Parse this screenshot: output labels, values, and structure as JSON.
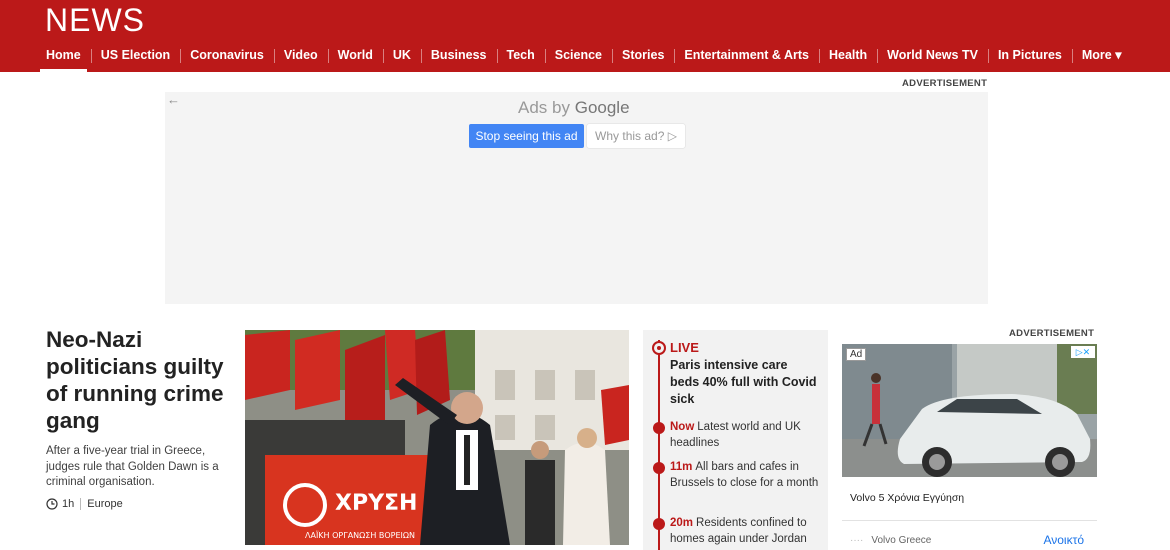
{
  "header": {
    "logo": "NEWS",
    "nav": [
      "Home",
      "US Election",
      "Coronavirus",
      "Video",
      "World",
      "UK",
      "Business",
      "Tech",
      "Science",
      "Stories",
      "Entertainment & Arts",
      "Health",
      "World News TV",
      "In Pictures",
      "More ▾"
    ],
    "active": "Home"
  },
  "top_ad": {
    "label": "ADVERTISEMENT",
    "ads_by": "Ads by",
    "google": "Google",
    "stop_label": "Stop seeing this ad",
    "why_label": "Why this ad? ▷",
    "back_icon": "arrow-left-icon"
  },
  "story": {
    "headline": "Neo-Nazi politicians guilty of running crime gang",
    "summary": "After a five-year trial in Greece, judges rule that Golden Dawn is a criminal organisation.",
    "time": "1h",
    "section": "Europe",
    "banner_text": "ΧΡΥΣΗ ΑΥ",
    "banner_subtext": "ΛΑΪΚΗ ΟΡΓΑΝΩΣΗ ΒΟΡΕΙΩΝ"
  },
  "live": {
    "tag": "LIVE",
    "title": "Paris intensive care beds 40% full with Covid sick",
    "entries": [
      {
        "time": "Now",
        "text": "Latest world and UK headlines"
      },
      {
        "time": "11m",
        "text": "All bars and cafes in Brussels to close for a month"
      },
      {
        "time": "20m",
        "text": "Residents confined to homes again under Jordan"
      }
    ]
  },
  "side_ad": {
    "label": "ADVERTISEMENT",
    "badge": "Ad",
    "caption": "Volvo 5 Χρόνια Εγγύηση",
    "advertiser": "Volvo Greece",
    "cta": "Ανοικτό"
  },
  "colors": {
    "brand": "#bb1919",
    "ad_button": "#4285f4"
  }
}
